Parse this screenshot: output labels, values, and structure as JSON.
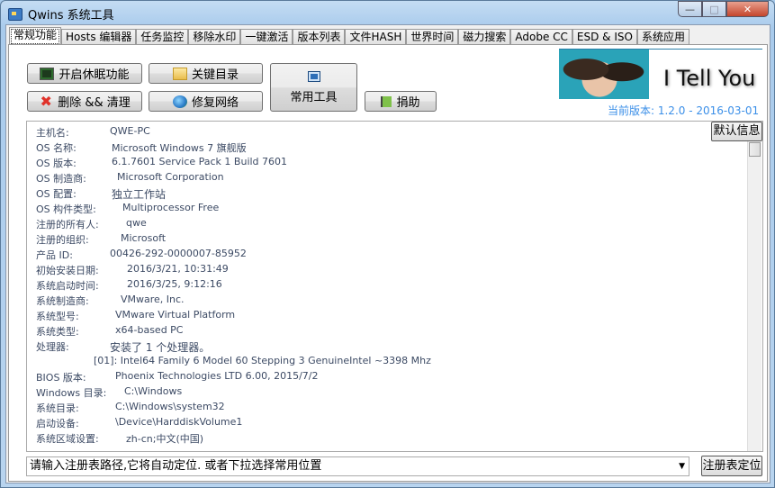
{
  "window": {
    "title": "Qwins 系统工具",
    "minimize": "—",
    "maximize": "□",
    "close": "✕"
  },
  "tabs": [
    "常规功能",
    "Hosts 编辑器",
    "任务监控",
    "移除水印",
    "一键激活",
    "版本列表",
    "文件HASH",
    "世界时间",
    "磁力搜索",
    "Adobe CC",
    "ESD & ISO",
    "系统应用"
  ],
  "buttons": {
    "sleep": "开启休眠功能",
    "key_dirs": "关键目录",
    "delete_clean": "删除 && 清理",
    "repair_network": "修复网络",
    "common_tools": "常用工具",
    "donate": "捐助",
    "default_info": "默认信息",
    "reg_locate": "注册表定位"
  },
  "logo": {
    "text": "I Tell You"
  },
  "version": "当前版本: 1.2.0 - 2016-03-01",
  "system_info": [
    {
      "label": "主机名:",
      "value": "QWE-PC"
    },
    {
      "label": "OS 名称:",
      "value": "Microsoft Windows 7 旗舰版"
    },
    {
      "label": "OS 版本:",
      "value": "6.1.7601 Service Pack 1 Build 7601"
    },
    {
      "label": "OS 制造商:",
      "value": "Microsoft Corporation"
    },
    {
      "label": "OS 配置:",
      "value": "独立工作站"
    },
    {
      "label": "OS 构件类型:",
      "value": "Multiprocessor Free"
    },
    {
      "label": "注册的所有人:",
      "value": "qwe"
    },
    {
      "label": "注册的组织:",
      "value": "Microsoft"
    },
    {
      "label": "产品 ID:",
      "value": "00426-292-0000007-85952"
    },
    {
      "label": "初始安装日期:",
      "value": "2016/3/21, 10:31:49"
    },
    {
      "label": "系统启动时间:",
      "value": "2016/3/25, 9:12:16"
    },
    {
      "label": "系统制造商:",
      "value": "VMware, Inc."
    },
    {
      "label": "系统型号:",
      "value": "VMware Virtual Platform"
    },
    {
      "label": "系统类型:",
      "value": "x64-based PC"
    },
    {
      "label": "处理器:",
      "value": "安装了 1 个处理器。"
    },
    {
      "label": "",
      "value": "[01]: Intel64 Family 6 Model 60 Stepping 3 GenuineIntel ~3398 Mhz"
    },
    {
      "label": "BIOS 版本:",
      "value": "Phoenix Technologies LTD 6.00, 2015/7/2"
    },
    {
      "label": "Windows 目录:",
      "value": "C:\\Windows"
    },
    {
      "label": "系统目录:",
      "value": "C:\\Windows\\system32"
    },
    {
      "label": "启动设备:",
      "value": "\\Device\\HarddiskVolume1"
    },
    {
      "label": "系统区域设置:",
      "value": "zh-cn;中文(中国)"
    }
  ],
  "registry_input": {
    "placeholder": "请输入注册表路径,它将自动定位. 或者下拉选择常用位置"
  }
}
